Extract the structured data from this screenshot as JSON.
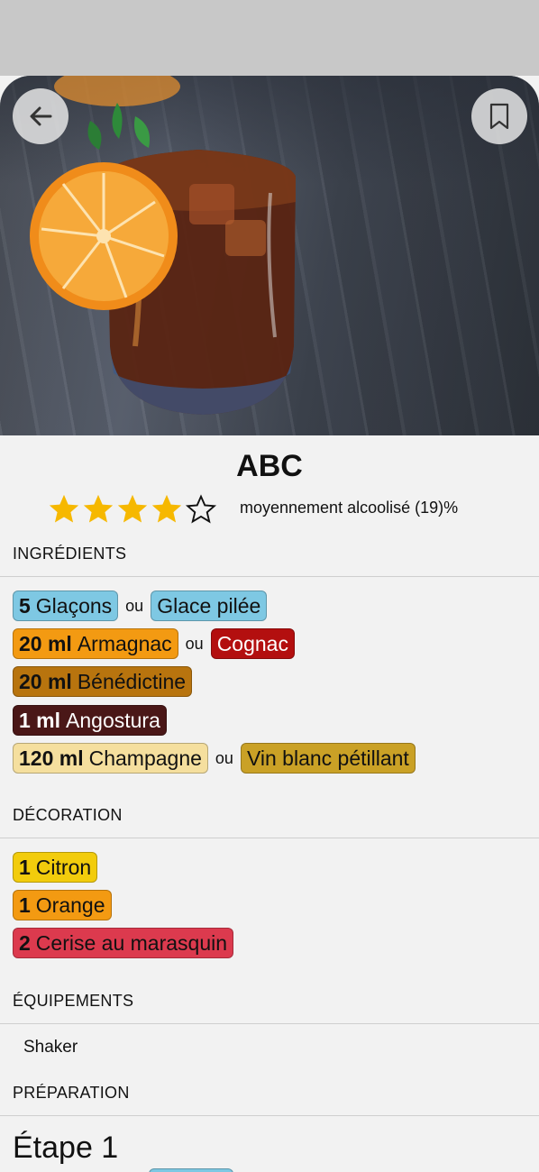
{
  "cocktail": {
    "name": "ABC",
    "rating": 4,
    "rating_max": 5,
    "alcohol_text": "moyennement alcoolisé (19)%"
  },
  "sections": {
    "ingredients": "INGRÉDIENTS",
    "decoration": "DÉCORATION",
    "equipment": "ÉQUIPEMENTS",
    "preparation": "PRÉPARATION"
  },
  "ingredients": [
    {
      "qty": "5",
      "name": "Glaçons",
      "color": "#7ec8e3",
      "text": "#111111",
      "alt": {
        "name": "Glace pilée",
        "color": "#7ec8e3",
        "text": "#111111"
      }
    },
    {
      "qty": "20 ml",
      "name": "Armagnac",
      "color": "#f39a12",
      "text": "#111111",
      "alt": {
        "name": "Cognac",
        "color": "#b30f0f",
        "text": "#ffffff"
      }
    },
    {
      "qty": "20 ml",
      "name": "Bénédictine",
      "color": "#b8740e",
      "text": "#111111"
    },
    {
      "qty": "1 ml",
      "name": "Angostura",
      "color": "#4a1717",
      "text": "#ffffff"
    },
    {
      "qty": "120 ml",
      "name": "Champagne",
      "color": "#f5df9e",
      "text": "#111111",
      "alt": {
        "name": "Vin blanc pétillant",
        "color": "#caa126",
        "text": "#111111"
      }
    }
  ],
  "or_label": "ou",
  "decorations": [
    {
      "qty": "1",
      "name": "Citron",
      "color": "#f2cc0c",
      "text": "#111111"
    },
    {
      "qty": "1",
      "name": "Orange",
      "color": "#f39a12",
      "text": "#111111"
    },
    {
      "qty": "2",
      "name": "Cerise au marasquin",
      "color": "#dc3a4e",
      "text": "#111111"
    }
  ],
  "equipment": [
    "Shaker"
  ],
  "preparation": {
    "step_title": "Étape 1"
  },
  "icons": {
    "back": "arrow-left-icon",
    "bookmark": "bookmark-icon",
    "star_filled": "star-filled-icon",
    "star_empty": "star-outline-icon"
  }
}
